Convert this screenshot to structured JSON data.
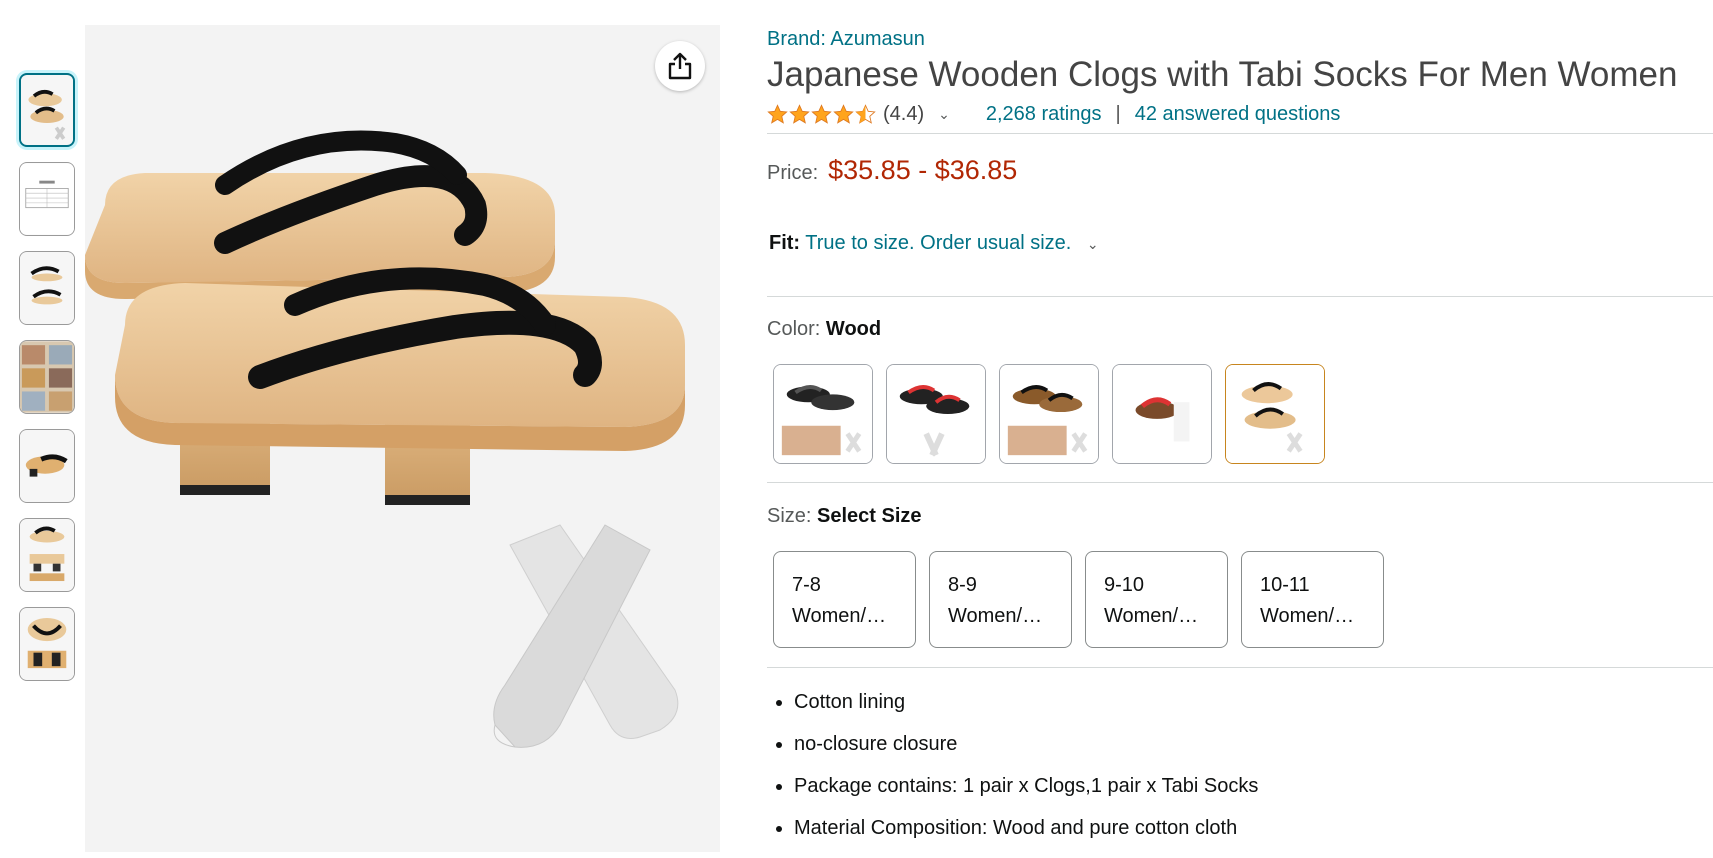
{
  "product": {
    "brand_label": "Brand: Azumasun",
    "title": "Japanese Wooden Clogs with Tabi Socks For Men Women",
    "rating_value": "(4.4)",
    "rating_stars": 4.4,
    "ratings_count": "2,268 ratings",
    "separator": "|",
    "answered_questions": "42 answered questions",
    "price_label": "Price:",
    "price_value": "$35.85 - $36.85",
    "fit_label": "Fit:",
    "fit_text": "True to size. Order usual size.",
    "color_label": "Color:",
    "color_value": "Wood",
    "size_label": "Size:",
    "size_value": "Select Size",
    "sizes": [
      {
        "line1": "7-8",
        "line2": "Women/…"
      },
      {
        "line1": "8-9",
        "line2": "Women/…"
      },
      {
        "line1": "9-10",
        "line2": "Women/…"
      },
      {
        "line1": "10-11",
        "line2": "Women/…"
      }
    ],
    "bullets": [
      "Cotton lining",
      "no-closure closure",
      "Package contains: 1 pair x Clogs,1 pair x Tabi Socks",
      "Material Composition: Wood and pure cotton cloth"
    ]
  },
  "colors": {
    "link": "#007185",
    "price": "#b12704",
    "star": "#ffa41c",
    "selected_swatch": "#c7851e",
    "selected_thumb": "#007185"
  },
  "icons": {
    "share": "share-icon",
    "chevron": "chevron-down-icon",
    "star": "star-icon"
  }
}
